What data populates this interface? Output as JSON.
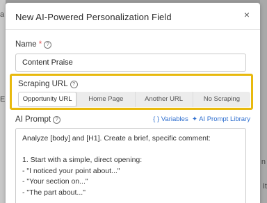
{
  "background": {
    "left_fragments": [
      "a",
      "",
      "E"
    ],
    "right_fragments": [
      "n",
      "It"
    ]
  },
  "modal": {
    "title": "New AI-Powered Personalization Field",
    "close_glyph": "×"
  },
  "name_field": {
    "label": "Name",
    "required_mark": "*",
    "help_glyph": "?",
    "value": "Content Praise"
  },
  "scraping": {
    "label": "Scraping URL",
    "help_glyph": "?",
    "options": [
      "Opportunity URL",
      "Home Page",
      "Another URL",
      "No Scraping"
    ],
    "selected": "Opportunity URL",
    "highlight_color": "#e8b90d"
  },
  "prompt": {
    "label": "AI Prompt",
    "help_glyph": "?",
    "variables_link": "Variables",
    "variables_icon": "{ }",
    "library_link": "AI Prompt Library",
    "library_icon": "✦",
    "lines": [
      "Analyze [body] and [H1]. Create a brief, specific comment:",
      "",
      "1. Start with a simple, direct opening:",
      "- \"I noticed your point about...\"",
      "- \"Your section on...\"",
      "- \"The part about...\""
    ]
  },
  "colors": {
    "link": "#2f6fcf",
    "required": "#e05555"
  }
}
